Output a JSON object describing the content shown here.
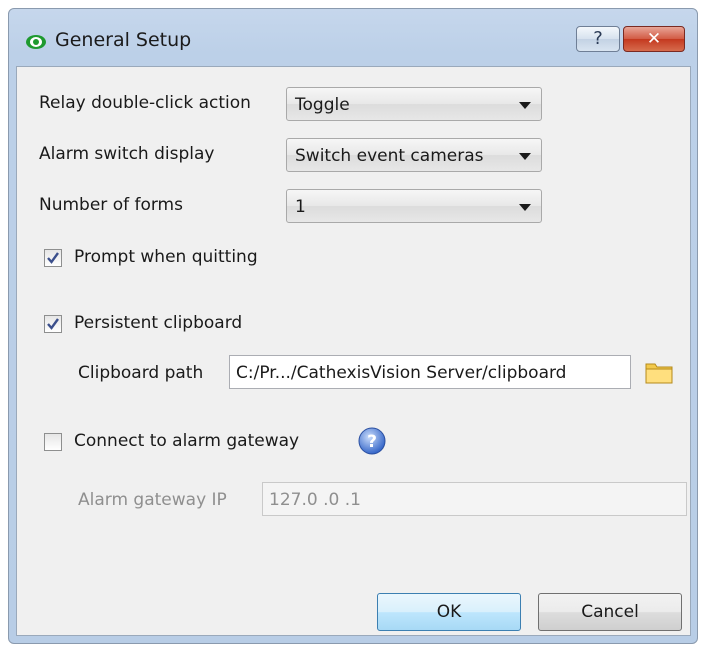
{
  "window": {
    "title": "General Setup",
    "help_glyph": "?",
    "close_glyph": "✕"
  },
  "form": {
    "relay_label": "Relay double-click action",
    "relay_value": "Toggle",
    "alarm_switch_label": "Alarm switch display",
    "alarm_switch_value": "Switch event cameras",
    "forms_label": "Number of forms",
    "forms_value": "1",
    "prompt_quit_label": "Prompt when quitting",
    "prompt_quit_checked": true,
    "persistent_clip_label": "Persistent clipboard",
    "persistent_clip_checked": true,
    "clip_path_label": "Clipboard path",
    "clip_path_value": "C:/Pr.../CathexisVision Server/clipboard",
    "gateway_label": "Connect to alarm gateway",
    "gateway_checked": false,
    "gateway_ip_label": "Alarm gateway IP",
    "gateway_ip_value": "127.0  .0  .1",
    "help_glyph": "?"
  },
  "buttons": {
    "ok": "OK",
    "cancel": "Cancel"
  },
  "icons": {
    "app": "eye-icon",
    "help": "question-icon",
    "close": "close-icon",
    "folder": "folder-icon",
    "info": "help-circle-icon",
    "dropdown": "chevron-down-icon"
  }
}
